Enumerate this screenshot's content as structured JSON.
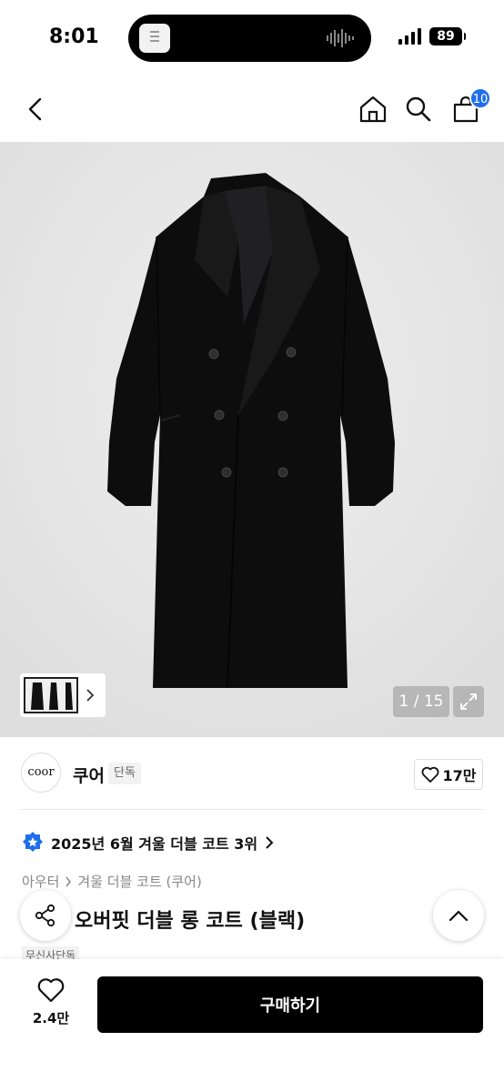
{
  "status_bar": {
    "time": "8:01",
    "battery": "89"
  },
  "top_nav": {
    "cart_count": "10"
  },
  "gallery": {
    "counter": "1 / 15"
  },
  "brand": {
    "logo_text": "coor",
    "name": "쿠어",
    "tag": "단독",
    "like_count": "17만"
  },
  "ranking": {
    "text": "2025년 6월 겨울 더블 코트 3위"
  },
  "breadcrumb": {
    "category": "아우터",
    "subcategory": "겨울 더블 코트 (쿠어)"
  },
  "product": {
    "title": "오버핏 더블 롱 코트 (블랙)",
    "tag": "무신사단독"
  },
  "bottom_bar": {
    "wish_count": "2.4만",
    "buy_label": "구매하기"
  },
  "colors": {
    "accent": "#1f6feb",
    "buy_button": "#000000",
    "background": "#ffffff"
  }
}
